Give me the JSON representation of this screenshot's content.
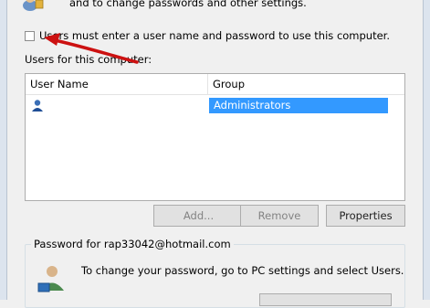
{
  "header": {
    "description_line": "and to change passwords and other settings."
  },
  "checkbox": {
    "label": "Users must enter a user name and password to use this computer.",
    "checked": false
  },
  "users_list": {
    "label": "Users for this computer:",
    "columns": [
      "User Name",
      "Group"
    ],
    "rows": [
      {
        "user_name": "",
        "group": "Administrators",
        "selected": true
      }
    ]
  },
  "buttons": {
    "add": "Add...",
    "remove": "Remove",
    "properties": "Properties"
  },
  "password_group": {
    "title": "Password for rap33042@hotmail.com",
    "text": "To change your password, go to PC settings and select Users."
  },
  "colors": {
    "selection": "#3399ff",
    "annotation_arrow": "#cc1111"
  },
  "icons": [
    "users-keys-icon",
    "user-icon",
    "user-password-icon"
  ]
}
